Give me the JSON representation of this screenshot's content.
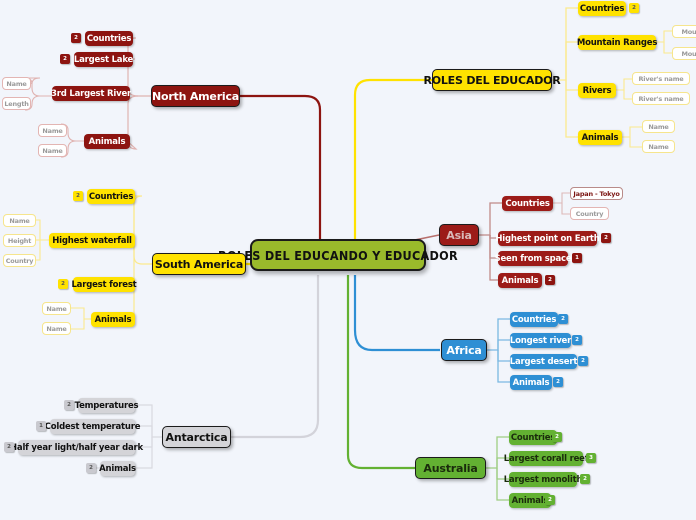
{
  "diagram": {
    "type": "mind-map",
    "background": "#f2f5fb",
    "central": {
      "label": "ROLES  DEL EDUCANDO Y EDUCADOR",
      "color": "#9aba2b"
    },
    "branches": [
      {
        "id": "north-america",
        "label": "North America",
        "color": "#8d1410",
        "side": "left",
        "children": [
          {
            "label": "Countries",
            "badge": "2"
          },
          {
            "label": "Largest Lake",
            "badge": "2"
          },
          {
            "label": "3rd Largest River",
            "badge": "",
            "leaves": [
              "Name",
              "Length"
            ]
          },
          {
            "label": "Animals",
            "badge": "",
            "leaves": [
              "Name",
              "Name"
            ]
          }
        ]
      },
      {
        "id": "south-america",
        "label": "South America",
        "color": "#ffe200",
        "side": "left",
        "children": [
          {
            "label": "Countries",
            "badge": "2"
          },
          {
            "label": "Highest waterfall",
            "badge": "",
            "leaves": [
              "Name",
              "Height",
              "Country"
            ]
          },
          {
            "label": "Largest forest",
            "badge": "2"
          },
          {
            "label": "Animals",
            "badge": "",
            "leaves": [
              "Name",
              "Name"
            ]
          }
        ]
      },
      {
        "id": "antarctica",
        "label": "Antarctica",
        "color": "#d4d4d8",
        "side": "left",
        "children": [
          {
            "label": "Temperatures",
            "badge": "2"
          },
          {
            "label": "Coldest temperature",
            "badge": "1"
          },
          {
            "label": "Half year light/half year dark",
            "badge": "2"
          },
          {
            "label": "Animals",
            "badge": "2"
          }
        ]
      },
      {
        "id": "roles-del-educador",
        "label": "ROLES DEL EDUCADOR",
        "color": "#ffe200",
        "side": "right",
        "children": [
          {
            "label": "Countries",
            "badge": "2"
          },
          {
            "label": "Mountain Ranges",
            "badge": "",
            "leaves": [
              "Mou",
              "Mou"
            ]
          },
          {
            "label": "Rivers",
            "badge": "",
            "leaves": [
              "River's name",
              "River's name"
            ]
          },
          {
            "label": "Animals",
            "badge": "",
            "leaves": [
              "Name",
              "Name"
            ]
          }
        ]
      },
      {
        "id": "asia",
        "label": "Asia",
        "color": "#9c1b18",
        "side": "right",
        "children": [
          {
            "label": "Countries",
            "badge": "",
            "leaves": [
              "Japan - Tokyo",
              "Country"
            ]
          },
          {
            "label": "Highest point on Earth",
            "badge": "2"
          },
          {
            "label": "Seen from space",
            "badge": "1"
          },
          {
            "label": "Animals",
            "badge": "2"
          }
        ]
      },
      {
        "id": "africa",
        "label": "Africa",
        "color": "#2e8fd4",
        "side": "right",
        "children": [
          {
            "label": "Countries",
            "badge": "2"
          },
          {
            "label": "Longest river",
            "badge": "2"
          },
          {
            "label": "Largest desert",
            "badge": "2"
          },
          {
            "label": "Animals",
            "badge": "2"
          }
        ]
      },
      {
        "id": "australia",
        "label": "Australia",
        "color": "#63b132",
        "side": "right",
        "children": [
          {
            "label": "Countries",
            "badge": "2"
          },
          {
            "label": "Largest corall reef",
            "badge": "3"
          },
          {
            "label": "Largest monolith",
            "badge": "2"
          },
          {
            "label": "Animals",
            "badge": "2"
          }
        ]
      }
    ]
  }
}
